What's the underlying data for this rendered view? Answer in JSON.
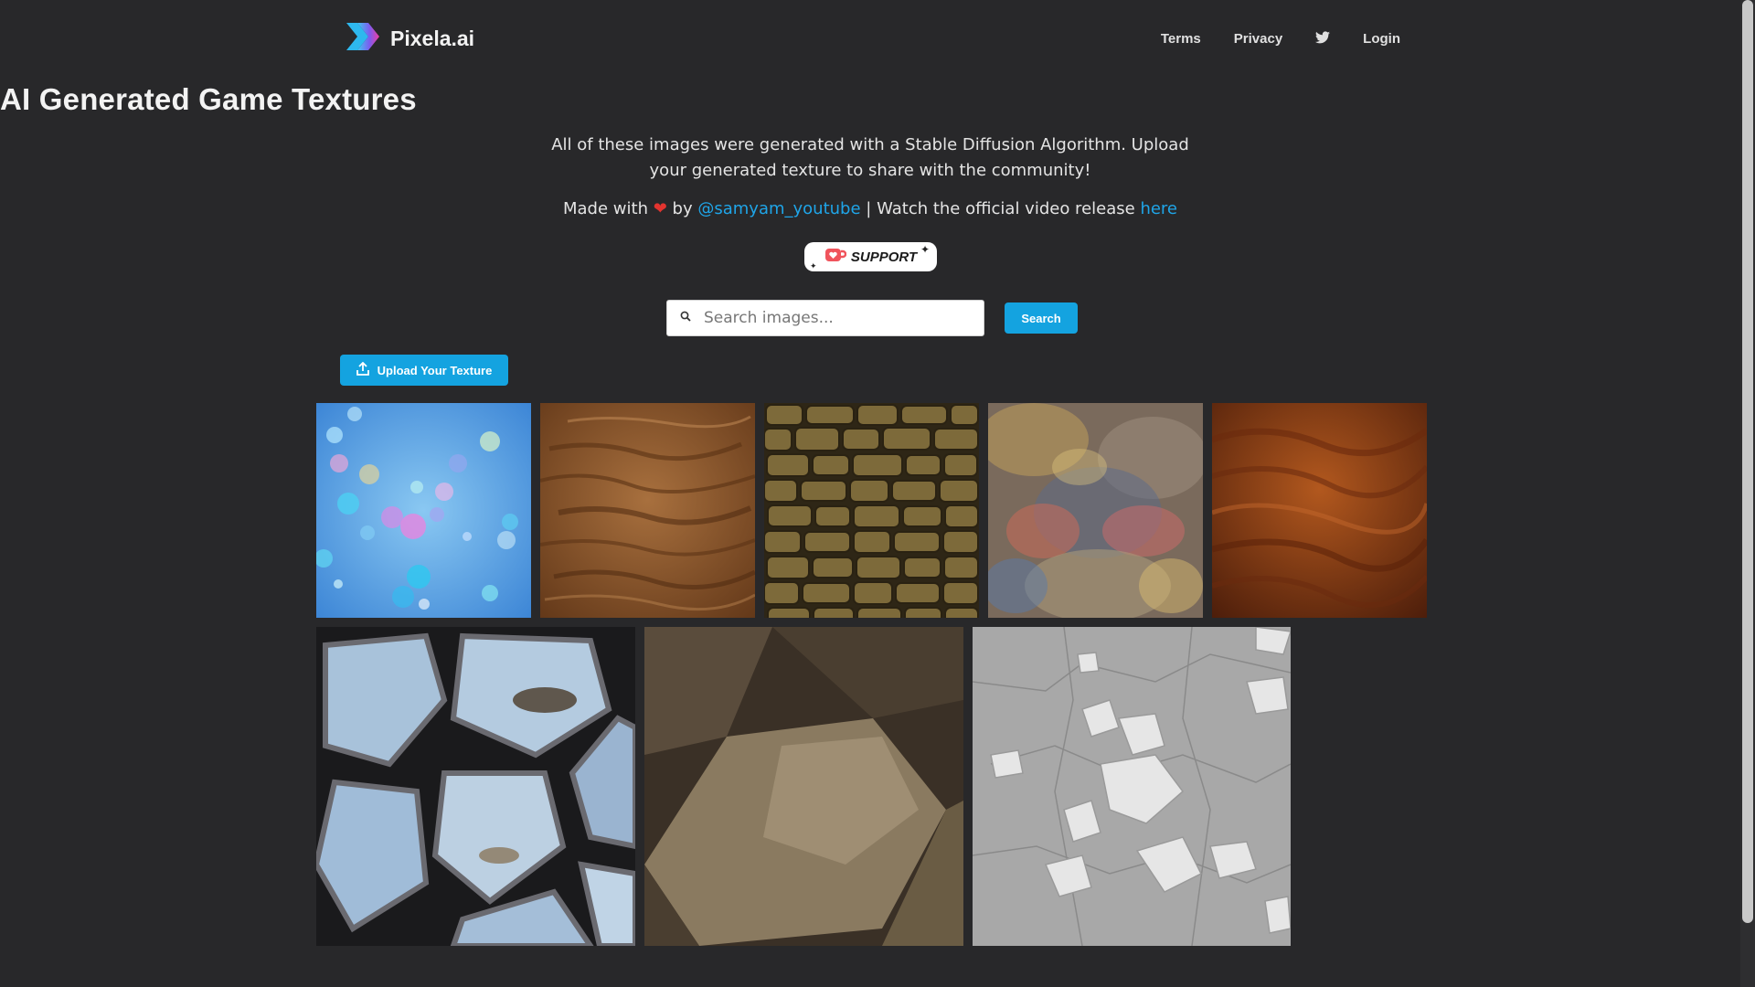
{
  "header": {
    "brand": "Pixela.ai",
    "nav": {
      "terms": "Terms",
      "privacy": "Privacy",
      "login": "Login"
    }
  },
  "hero": {
    "title": "AI Generated Game Textures",
    "description": "All of these images were generated with a Stable Diffusion Algorithm. Upload your generated texture to share with the community!",
    "made_prefix": "Made with",
    "made_by": "by",
    "author": "@samyam_youtube",
    "separator": "| Watch the official video release",
    "video_link": "here"
  },
  "support_badge": {
    "label": "SUPPORT"
  },
  "search": {
    "placeholder": "Search images...",
    "button": "Search"
  },
  "upload": {
    "label": "Upload Your Texture"
  },
  "gallery": [
    {
      "name": "bubbles-texture",
      "colors": [
        "#6ab7ef",
        "#4a8fd8"
      ]
    },
    {
      "name": "wood-grain-texture",
      "colors": [
        "#8a5028",
        "#a86a38"
      ]
    },
    {
      "name": "stone-wall-texture",
      "colors": [
        "#6e5a30",
        "#3a2f18"
      ]
    },
    {
      "name": "iridescent-texture",
      "colors": [
        "#8a7868",
        "#5a6a88"
      ]
    },
    {
      "name": "red-wood-texture",
      "colors": [
        "#9a4618",
        "#5a2410"
      ]
    },
    {
      "name": "crystal-cells-texture",
      "colors": [
        "#a8c0d8",
        "#1a1a1a"
      ]
    },
    {
      "name": "rock-texture",
      "colors": [
        "#7a6a52",
        "#3a3028"
      ]
    },
    {
      "name": "snow-rocks-texture",
      "colors": [
        "#c8c8c8",
        "#8a8a8a"
      ]
    }
  ],
  "colors": {
    "background": "#28282a",
    "accent": "#14a3e0",
    "link": "#1fa5e8"
  }
}
